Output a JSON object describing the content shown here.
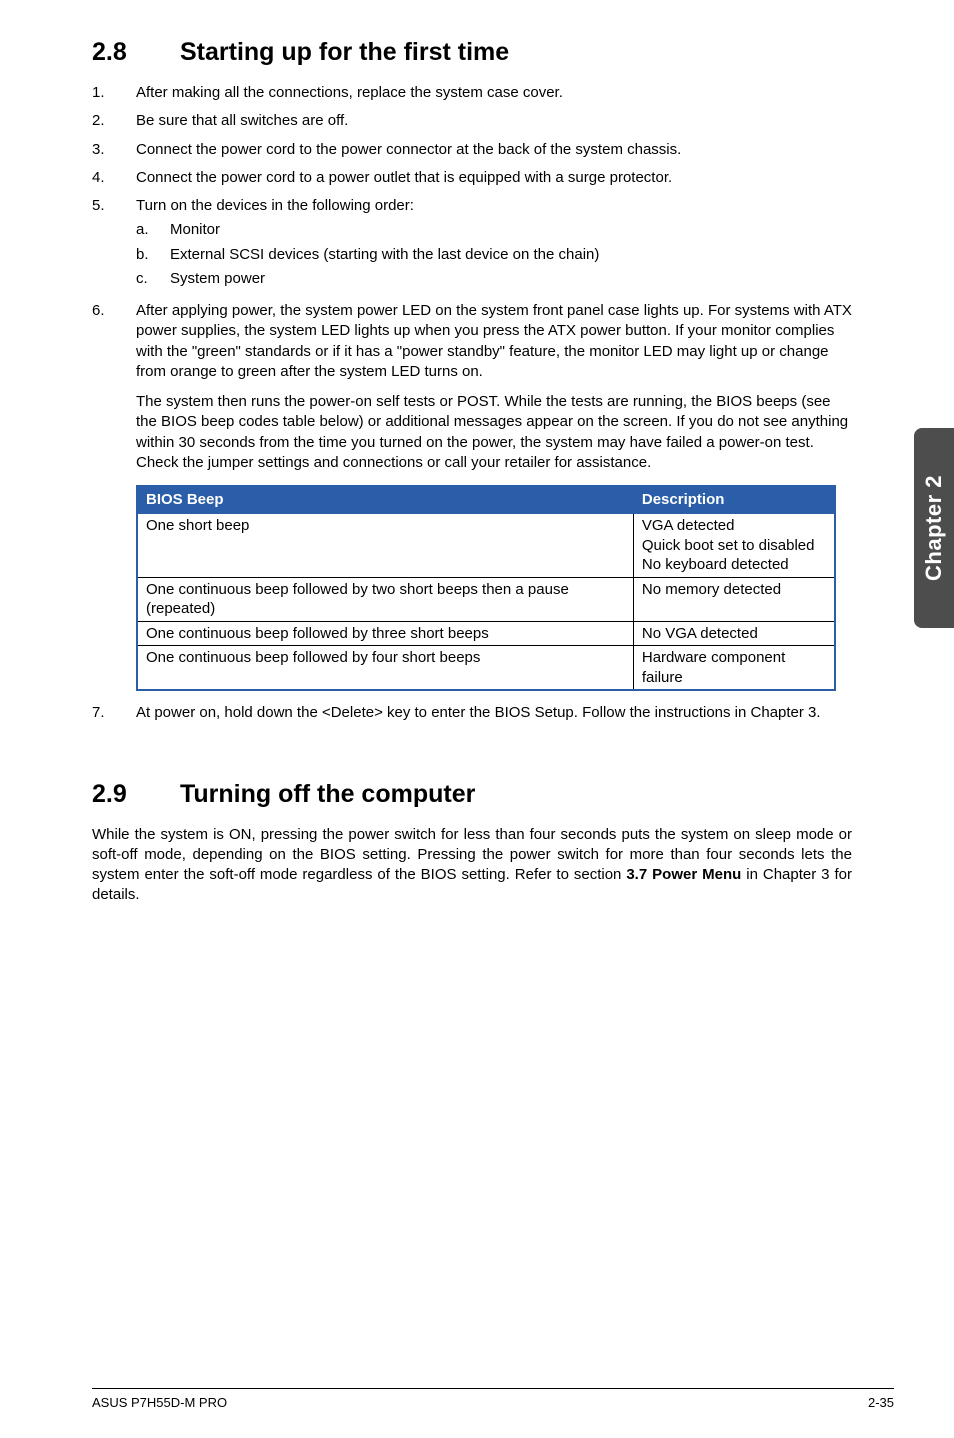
{
  "section28": {
    "number": "2.8",
    "title": "Starting up for the first time",
    "steps": [
      {
        "n": "1.",
        "text": "After making all the connections, replace the system case cover."
      },
      {
        "n": "2.",
        "text": "Be sure that all switches are off."
      },
      {
        "n": "3.",
        "text": "Connect the power cord to the power connector at the back of the system chassis."
      },
      {
        "n": "4.",
        "text": "Connect the power cord to a power outlet that is equipped with a surge protector."
      },
      {
        "n": "5.",
        "text": "Turn on the devices in the following order:",
        "sub": [
          {
            "n": "a.",
            "text": "Monitor"
          },
          {
            "n": "b.",
            "text": "External SCSI devices (starting with the last device on the chain)"
          },
          {
            "n": "c.",
            "text": "System power"
          }
        ]
      },
      {
        "n": "6.",
        "text": "After applying power, the system power LED on the system front panel case lights up. For systems with ATX power supplies, the system LED lights up when you press the ATX power button. If your monitor complies with the \"green\" standards or if it has a \"power standby\" feature, the monitor LED may light up or change from orange to green after the system LED turns on.",
        "para2": "The system then runs the power-on self tests or POST. While the tests are running, the BIOS beeps (see the BIOS beep codes table below) or additional messages appear on the screen. If you do not see anything within 30 seconds from the time you turned on the power, the system may have failed a power-on test. Check the jumper settings and connections or call your retailer for assistance."
      }
    ],
    "table": {
      "headers": [
        "BIOS Beep",
        "Description"
      ],
      "rows": [
        [
          "One short beep",
          "VGA detected\nQuick boot set to disabled\nNo keyboard detected"
        ],
        [
          "One continuous beep followed by two short beeps then a pause (repeated)",
          "No memory detected"
        ],
        [
          "One continuous beep followed by three short beeps",
          "No VGA detected"
        ],
        [
          "One continuous beep followed by four short beeps",
          "Hardware component failure"
        ]
      ]
    },
    "step7": {
      "n": "7.",
      "text": "At power on, hold down the <Delete> key to enter the BIOS Setup. Follow the instructions in Chapter 3."
    }
  },
  "section29": {
    "number": "2.9",
    "title": "Turning off the computer",
    "body_parts": [
      "While the system is ON, pressing the power switch for less than four seconds puts the system on sleep mode or soft-off mode, depending on the BIOS setting. Pressing the power switch for more than four seconds lets the system enter the soft-off mode regardless of the BIOS setting. Refer to section ",
      "3.7 Power Menu",
      " in Chapter 3 for details."
    ]
  },
  "sidetab": "Chapter 2",
  "footer": {
    "left": "ASUS P7H55D-M PRO",
    "right": "2-35"
  }
}
